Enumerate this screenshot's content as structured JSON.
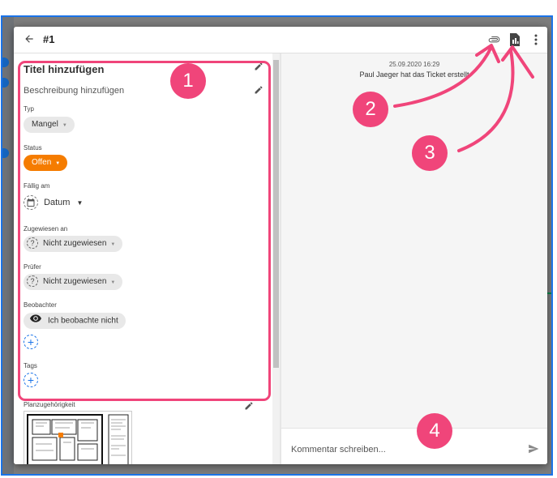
{
  "header": {
    "ticket_number": "#1",
    "icons": [
      "back-arrow-icon",
      "paperclip-icon",
      "pdf-export-icon",
      "more-vert-icon"
    ]
  },
  "details": {
    "title_placeholder": "Titel hinzufügen",
    "description_placeholder": "Beschreibung hinzufügen",
    "type_label": "Typ",
    "type_value": "Mangel",
    "status_label": "Status",
    "status_value": "Offen",
    "status_color": "#f57c00",
    "due_label": "Fällig am",
    "due_value": "Datum",
    "assigned_label": "Zugewiesen an",
    "assigned_value": "Nicht zugewiesen",
    "reviewer_label": "Prüfer",
    "reviewer_value": "Nicht zugewiesen",
    "watchers_label": "Beobachter",
    "watch_value": "Ich beobachte nicht",
    "tags_label": "Tags",
    "plan_label": "Planzugehörigkeit"
  },
  "activity": {
    "timestamp": "25.09.2020 16:29",
    "message": "Paul Jaeger hat das Ticket erstellt"
  },
  "comment": {
    "placeholder": "Kommentar schreiben..."
  },
  "annotations": {
    "badge_1": "1",
    "badge_2": "2",
    "badge_3": "3",
    "badge_4": "4",
    "accent_color": "#f0457a"
  }
}
